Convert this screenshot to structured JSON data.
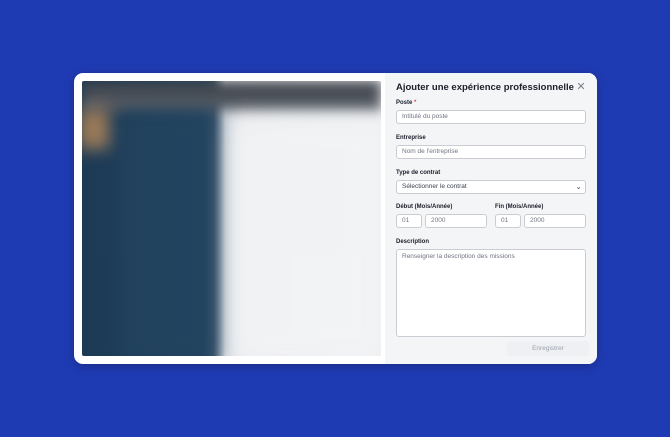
{
  "modal": {
    "title": "Ajouter une expérience professionnelle",
    "close_icon": "close-icon",
    "fields": {
      "poste": {
        "label": "Poste",
        "required_mark": "*",
        "placeholder": "Intitulé du poste"
      },
      "entreprise": {
        "label": "Entreprise",
        "placeholder": "Nom de l'entreprise"
      },
      "contrat": {
        "label": "Type de contrat",
        "value": "Sélectionner le contrat",
        "icon": "chevron-down-icon"
      },
      "debut": {
        "label": "Début (Mois/Année)",
        "month": "01",
        "year": "2000"
      },
      "fin": {
        "label": "Fin (Mois/Année)",
        "month": "01",
        "year": "2000"
      },
      "description": {
        "label": "Description",
        "placeholder": "Renseigner la description des missions"
      }
    },
    "save_label": "Enregistrer"
  },
  "colors": {
    "background": "#1f3bb3",
    "panel": "#f4f5f7",
    "required": "#e0404b"
  }
}
